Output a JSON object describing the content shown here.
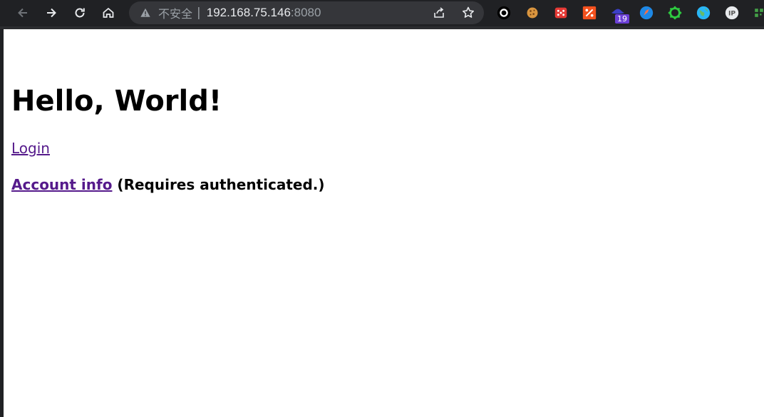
{
  "browser": {
    "security_label": "不安全",
    "separator": "|",
    "url_host": "192.168.75.146",
    "url_port": ":8080",
    "extensions": [
      "circle-icon",
      "cookie-icon",
      "dice-icon",
      "percent-icon",
      "hat-icon",
      "rocket-icon",
      "gear-icon",
      "globe-icon",
      "ip-icon",
      "grid-icon"
    ],
    "extension_badge": "19"
  },
  "page": {
    "heading": "Hello, World!",
    "login_link": "Login",
    "account_link": "Account info",
    "account_note": " (Requires authenticated.)"
  },
  "colors": {
    "toolbar_bg": "#202124",
    "omnibox_bg": "#35363a",
    "visited_link": "#551a8b",
    "badge": "#6b3fd6"
  }
}
